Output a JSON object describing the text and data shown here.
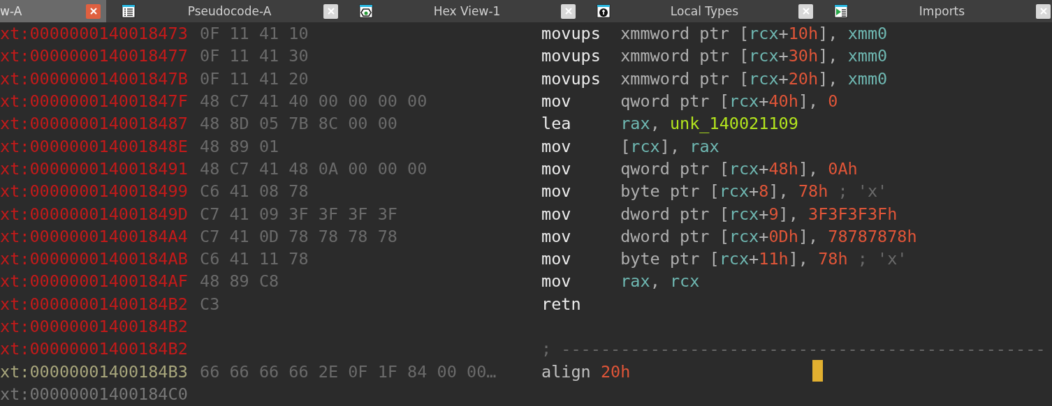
{
  "tabs": [
    {
      "label": "w-A",
      "kind": "disasm",
      "selected": true
    },
    {
      "label": "Pseudocode-A",
      "kind": "pseudocode",
      "selected": false
    },
    {
      "label": "Hex View-1",
      "kind": "hex",
      "selected": false
    },
    {
      "label": "Local Types",
      "kind": "types",
      "selected": false
    },
    {
      "label": "Imports",
      "kind": "imports",
      "selected": false
    }
  ],
  "lines": [
    {
      "address": "xt:0000000140018473",
      "kind": "code",
      "bytes": "0F 11 41 10",
      "mnemonic": "movups",
      "operands": [
        {
          "kind": "text",
          "text": "xmmword ptr ["
        },
        {
          "kind": "reg",
          "text": "rcx"
        },
        {
          "kind": "text",
          "text": "+"
        },
        {
          "kind": "num",
          "text": "10h"
        },
        {
          "kind": "text",
          "text": "], "
        },
        {
          "kind": "reg",
          "text": "xmm0"
        }
      ],
      "cursor": false
    },
    {
      "address": "xt:0000000140018477",
      "kind": "code",
      "bytes": "0F 11 41 30",
      "mnemonic": "movups",
      "operands": [
        {
          "kind": "text",
          "text": "xmmword ptr ["
        },
        {
          "kind": "reg",
          "text": "rcx"
        },
        {
          "kind": "text",
          "text": "+"
        },
        {
          "kind": "num",
          "text": "30h"
        },
        {
          "kind": "text",
          "text": "], "
        },
        {
          "kind": "reg",
          "text": "xmm0"
        }
      ],
      "cursor": false
    },
    {
      "address": "xt:000000014001847B",
      "kind": "code",
      "bytes": "0F 11 41 20",
      "mnemonic": "movups",
      "operands": [
        {
          "kind": "text",
          "text": "xmmword ptr ["
        },
        {
          "kind": "reg",
          "text": "rcx"
        },
        {
          "kind": "text",
          "text": "+"
        },
        {
          "kind": "num",
          "text": "20h"
        },
        {
          "kind": "text",
          "text": "], "
        },
        {
          "kind": "reg",
          "text": "xmm0"
        }
      ],
      "cursor": false
    },
    {
      "address": "xt:000000014001847F",
      "kind": "code",
      "bytes": "48 C7 41 40 00 00 00 00",
      "mnemonic": "mov",
      "operands": [
        {
          "kind": "text",
          "text": "qword ptr ["
        },
        {
          "kind": "reg",
          "text": "rcx"
        },
        {
          "kind": "text",
          "text": "+"
        },
        {
          "kind": "num",
          "text": "40h"
        },
        {
          "kind": "text",
          "text": "], "
        },
        {
          "kind": "num",
          "text": "0"
        }
      ],
      "cursor": false
    },
    {
      "address": "xt:0000000140018487",
      "kind": "code",
      "bytes": "48 8D 05 7B 8C 00 00",
      "mnemonic": "lea",
      "operands": [
        {
          "kind": "reg",
          "text": "rax"
        },
        {
          "kind": "text",
          "text": ", "
        },
        {
          "kind": "name",
          "text": "unk_140021109"
        }
      ],
      "cursor": false
    },
    {
      "address": "xt:000000014001848E",
      "kind": "code",
      "bytes": "48 89 01",
      "mnemonic": "mov",
      "operands": [
        {
          "kind": "text",
          "text": "["
        },
        {
          "kind": "reg",
          "text": "rcx"
        },
        {
          "kind": "text",
          "text": "], "
        },
        {
          "kind": "reg",
          "text": "rax"
        }
      ],
      "cursor": false
    },
    {
      "address": "xt:0000000140018491",
      "kind": "code",
      "bytes": "48 C7 41 48 0A 00 00 00",
      "mnemonic": "mov",
      "operands": [
        {
          "kind": "text",
          "text": "qword ptr ["
        },
        {
          "kind": "reg",
          "text": "rcx"
        },
        {
          "kind": "text",
          "text": "+"
        },
        {
          "kind": "num",
          "text": "48h"
        },
        {
          "kind": "text",
          "text": "], "
        },
        {
          "kind": "num",
          "text": "0Ah"
        }
      ],
      "cursor": false
    },
    {
      "address": "xt:0000000140018499",
      "kind": "code",
      "bytes": "C6 41 08 78",
      "mnemonic": "mov",
      "operands": [
        {
          "kind": "text",
          "text": "byte ptr ["
        },
        {
          "kind": "reg",
          "text": "rcx"
        },
        {
          "kind": "text",
          "text": "+"
        },
        {
          "kind": "num",
          "text": "8"
        },
        {
          "kind": "text",
          "text": "], "
        },
        {
          "kind": "num",
          "text": "78h"
        },
        {
          "kind": "comment",
          "text": " ; 'x'"
        }
      ],
      "cursor": false
    },
    {
      "address": "xt:000000014001849D",
      "kind": "code",
      "bytes": "C7 41 09 3F 3F 3F 3F",
      "mnemonic": "mov",
      "operands": [
        {
          "kind": "text",
          "text": "dword ptr ["
        },
        {
          "kind": "reg",
          "text": "rcx"
        },
        {
          "kind": "text",
          "text": "+"
        },
        {
          "kind": "num",
          "text": "9"
        },
        {
          "kind": "text",
          "text": "], "
        },
        {
          "kind": "num",
          "text": "3F3F3F3Fh"
        }
      ],
      "cursor": false
    },
    {
      "address": "xt:00000001400184A4",
      "kind": "code",
      "bytes": "C7 41 0D 78 78 78 78",
      "mnemonic": "mov",
      "operands": [
        {
          "kind": "text",
          "text": "dword ptr ["
        },
        {
          "kind": "reg",
          "text": "rcx"
        },
        {
          "kind": "text",
          "text": "+"
        },
        {
          "kind": "num",
          "text": "0Dh"
        },
        {
          "kind": "text",
          "text": "], "
        },
        {
          "kind": "num",
          "text": "78787878h"
        }
      ],
      "cursor": false
    },
    {
      "address": "xt:00000001400184AB",
      "kind": "code",
      "bytes": "C6 41 11 78",
      "mnemonic": "mov",
      "operands": [
        {
          "kind": "text",
          "text": "byte ptr ["
        },
        {
          "kind": "reg",
          "text": "rcx"
        },
        {
          "kind": "text",
          "text": "+"
        },
        {
          "kind": "num",
          "text": "11h"
        },
        {
          "kind": "text",
          "text": "], "
        },
        {
          "kind": "num",
          "text": "78h"
        },
        {
          "kind": "comment",
          "text": " ; 'x'"
        }
      ],
      "cursor": false
    },
    {
      "address": "xt:00000001400184AF",
      "kind": "code",
      "bytes": "48 89 C8",
      "mnemonic": "mov",
      "operands": [
        {
          "kind": "reg",
          "text": "rax"
        },
        {
          "kind": "text",
          "text": ", "
        },
        {
          "kind": "reg",
          "text": "rcx"
        }
      ],
      "cursor": false
    },
    {
      "address": "xt:00000001400184B2",
      "kind": "code",
      "bytes": "C3",
      "mnemonic": "retn",
      "cursor": false
    },
    {
      "address": "xt:00000001400184B2",
      "kind": "code",
      "cursor": false
    },
    {
      "address": "xt:00000001400184B2",
      "kind": "code",
      "comment": "; -------------------------------------------------",
      "cursor": false
    },
    {
      "address": "xt:00000001400184B3",
      "kind": "data",
      "bytes": "66 66 66 66 2E 0F 1F 84 00 00…",
      "mnemonic": "align",
      "operands": [
        {
          "kind": "num",
          "text": "20h"
        }
      ],
      "cursor": true
    },
    {
      "address": "xt:00000001400184C0",
      "kind": "other",
      "cursor": false
    }
  ]
}
